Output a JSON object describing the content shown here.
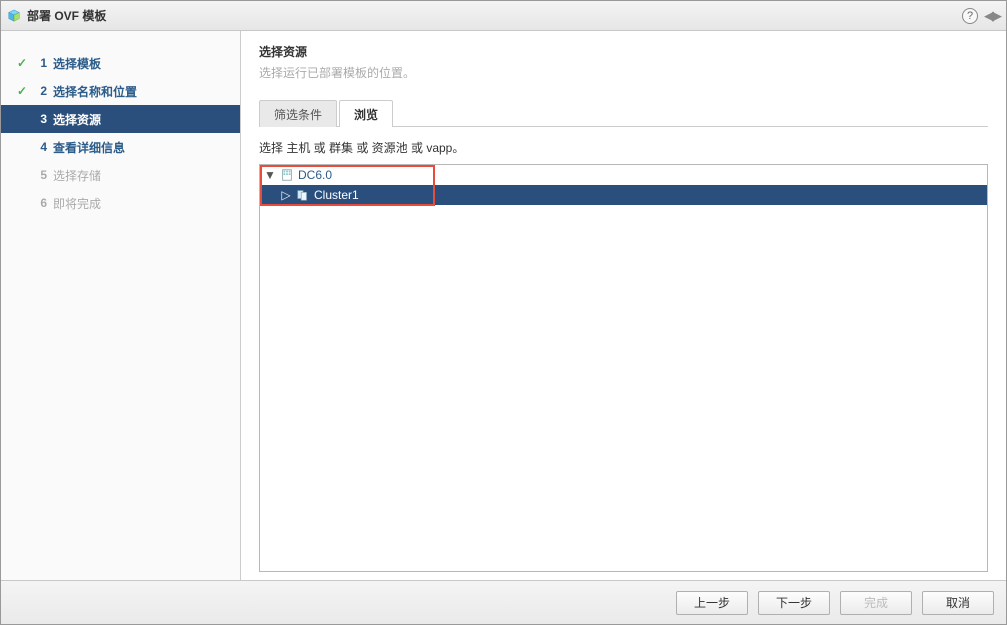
{
  "window": {
    "title": "部署 OVF 模板"
  },
  "steps": [
    {
      "num": "1",
      "label": "选择模板",
      "state": "completed"
    },
    {
      "num": "2",
      "label": "选择名称和位置",
      "state": "completed"
    },
    {
      "num": "3",
      "label": "选择资源",
      "state": "active"
    },
    {
      "num": "4",
      "label": "查看详细信息",
      "state": "upcoming"
    },
    {
      "num": "5",
      "label": "选择存储",
      "state": "disabled"
    },
    {
      "num": "6",
      "label": "即将完成",
      "state": "disabled"
    }
  ],
  "content": {
    "heading": "选择资源",
    "sub": "选择运行已部署模板的位置。",
    "tabs": [
      {
        "label": "筛选条件",
        "active": false
      },
      {
        "label": "浏览",
        "active": true
      }
    ],
    "instruction": "选择 主机 或 群集 或 资源池 或 vapp。",
    "tree": {
      "root": {
        "label": "DC6.0",
        "expand_symbol": "▼"
      },
      "child": {
        "label": "Cluster1",
        "expand_symbol": "▷"
      }
    }
  },
  "buttons": {
    "back": "上一步",
    "next": "下一步",
    "finish": "完成",
    "cancel": "取消"
  },
  "icons": {
    "checkmark": "✓",
    "help": "?"
  }
}
